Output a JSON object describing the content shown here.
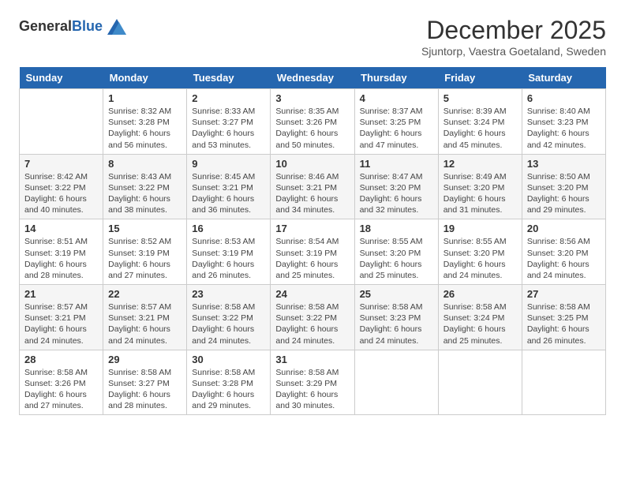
{
  "header": {
    "logo_general": "General",
    "logo_blue": "Blue",
    "month_title": "December 2025",
    "location": "Sjuntorp, Vaestra Goetaland, Sweden"
  },
  "days_of_week": [
    "Sunday",
    "Monday",
    "Tuesday",
    "Wednesday",
    "Thursday",
    "Friday",
    "Saturday"
  ],
  "weeks": [
    [
      {
        "day": "",
        "sunrise": "",
        "sunset": "",
        "daylight": ""
      },
      {
        "day": "1",
        "sunrise": "Sunrise: 8:32 AM",
        "sunset": "Sunset: 3:28 PM",
        "daylight": "Daylight: 6 hours and 56 minutes."
      },
      {
        "day": "2",
        "sunrise": "Sunrise: 8:33 AM",
        "sunset": "Sunset: 3:27 PM",
        "daylight": "Daylight: 6 hours and 53 minutes."
      },
      {
        "day": "3",
        "sunrise": "Sunrise: 8:35 AM",
        "sunset": "Sunset: 3:26 PM",
        "daylight": "Daylight: 6 hours and 50 minutes."
      },
      {
        "day": "4",
        "sunrise": "Sunrise: 8:37 AM",
        "sunset": "Sunset: 3:25 PM",
        "daylight": "Daylight: 6 hours and 47 minutes."
      },
      {
        "day": "5",
        "sunrise": "Sunrise: 8:39 AM",
        "sunset": "Sunset: 3:24 PM",
        "daylight": "Daylight: 6 hours and 45 minutes."
      },
      {
        "day": "6",
        "sunrise": "Sunrise: 8:40 AM",
        "sunset": "Sunset: 3:23 PM",
        "daylight": "Daylight: 6 hours and 42 minutes."
      }
    ],
    [
      {
        "day": "7",
        "sunrise": "Sunrise: 8:42 AM",
        "sunset": "Sunset: 3:22 PM",
        "daylight": "Daylight: 6 hours and 40 minutes."
      },
      {
        "day": "8",
        "sunrise": "Sunrise: 8:43 AM",
        "sunset": "Sunset: 3:22 PM",
        "daylight": "Daylight: 6 hours and 38 minutes."
      },
      {
        "day": "9",
        "sunrise": "Sunrise: 8:45 AM",
        "sunset": "Sunset: 3:21 PM",
        "daylight": "Daylight: 6 hours and 36 minutes."
      },
      {
        "day": "10",
        "sunrise": "Sunrise: 8:46 AM",
        "sunset": "Sunset: 3:21 PM",
        "daylight": "Daylight: 6 hours and 34 minutes."
      },
      {
        "day": "11",
        "sunrise": "Sunrise: 8:47 AM",
        "sunset": "Sunset: 3:20 PM",
        "daylight": "Daylight: 6 hours and 32 minutes."
      },
      {
        "day": "12",
        "sunrise": "Sunrise: 8:49 AM",
        "sunset": "Sunset: 3:20 PM",
        "daylight": "Daylight: 6 hours and 31 minutes."
      },
      {
        "day": "13",
        "sunrise": "Sunrise: 8:50 AM",
        "sunset": "Sunset: 3:20 PM",
        "daylight": "Daylight: 6 hours and 29 minutes."
      }
    ],
    [
      {
        "day": "14",
        "sunrise": "Sunrise: 8:51 AM",
        "sunset": "Sunset: 3:19 PM",
        "daylight": "Daylight: 6 hours and 28 minutes."
      },
      {
        "day": "15",
        "sunrise": "Sunrise: 8:52 AM",
        "sunset": "Sunset: 3:19 PM",
        "daylight": "Daylight: 6 hours and 27 minutes."
      },
      {
        "day": "16",
        "sunrise": "Sunrise: 8:53 AM",
        "sunset": "Sunset: 3:19 PM",
        "daylight": "Daylight: 6 hours and 26 minutes."
      },
      {
        "day": "17",
        "sunrise": "Sunrise: 8:54 AM",
        "sunset": "Sunset: 3:19 PM",
        "daylight": "Daylight: 6 hours and 25 minutes."
      },
      {
        "day": "18",
        "sunrise": "Sunrise: 8:55 AM",
        "sunset": "Sunset: 3:20 PM",
        "daylight": "Daylight: 6 hours and 25 minutes."
      },
      {
        "day": "19",
        "sunrise": "Sunrise: 8:55 AM",
        "sunset": "Sunset: 3:20 PM",
        "daylight": "Daylight: 6 hours and 24 minutes."
      },
      {
        "day": "20",
        "sunrise": "Sunrise: 8:56 AM",
        "sunset": "Sunset: 3:20 PM",
        "daylight": "Daylight: 6 hours and 24 minutes."
      }
    ],
    [
      {
        "day": "21",
        "sunrise": "Sunrise: 8:57 AM",
        "sunset": "Sunset: 3:21 PM",
        "daylight": "Daylight: 6 hours and 24 minutes."
      },
      {
        "day": "22",
        "sunrise": "Sunrise: 8:57 AM",
        "sunset": "Sunset: 3:21 PM",
        "daylight": "Daylight: 6 hours and 24 minutes."
      },
      {
        "day": "23",
        "sunrise": "Sunrise: 8:58 AM",
        "sunset": "Sunset: 3:22 PM",
        "daylight": "Daylight: 6 hours and 24 minutes."
      },
      {
        "day": "24",
        "sunrise": "Sunrise: 8:58 AM",
        "sunset": "Sunset: 3:22 PM",
        "daylight": "Daylight: 6 hours and 24 minutes."
      },
      {
        "day": "25",
        "sunrise": "Sunrise: 8:58 AM",
        "sunset": "Sunset: 3:23 PM",
        "daylight": "Daylight: 6 hours and 24 minutes."
      },
      {
        "day": "26",
        "sunrise": "Sunrise: 8:58 AM",
        "sunset": "Sunset: 3:24 PM",
        "daylight": "Daylight: 6 hours and 25 minutes."
      },
      {
        "day": "27",
        "sunrise": "Sunrise: 8:58 AM",
        "sunset": "Sunset: 3:25 PM",
        "daylight": "Daylight: 6 hours and 26 minutes."
      }
    ],
    [
      {
        "day": "28",
        "sunrise": "Sunrise: 8:58 AM",
        "sunset": "Sunset: 3:26 PM",
        "daylight": "Daylight: 6 hours and 27 minutes."
      },
      {
        "day": "29",
        "sunrise": "Sunrise: 8:58 AM",
        "sunset": "Sunset: 3:27 PM",
        "daylight": "Daylight: 6 hours and 28 minutes."
      },
      {
        "day": "30",
        "sunrise": "Sunrise: 8:58 AM",
        "sunset": "Sunset: 3:28 PM",
        "daylight": "Daylight: 6 hours and 29 minutes."
      },
      {
        "day": "31",
        "sunrise": "Sunrise: 8:58 AM",
        "sunset": "Sunset: 3:29 PM",
        "daylight": "Daylight: 6 hours and 30 minutes."
      },
      {
        "day": "",
        "sunrise": "",
        "sunset": "",
        "daylight": ""
      },
      {
        "day": "",
        "sunrise": "",
        "sunset": "",
        "daylight": ""
      },
      {
        "day": "",
        "sunrise": "",
        "sunset": "",
        "daylight": ""
      }
    ]
  ]
}
